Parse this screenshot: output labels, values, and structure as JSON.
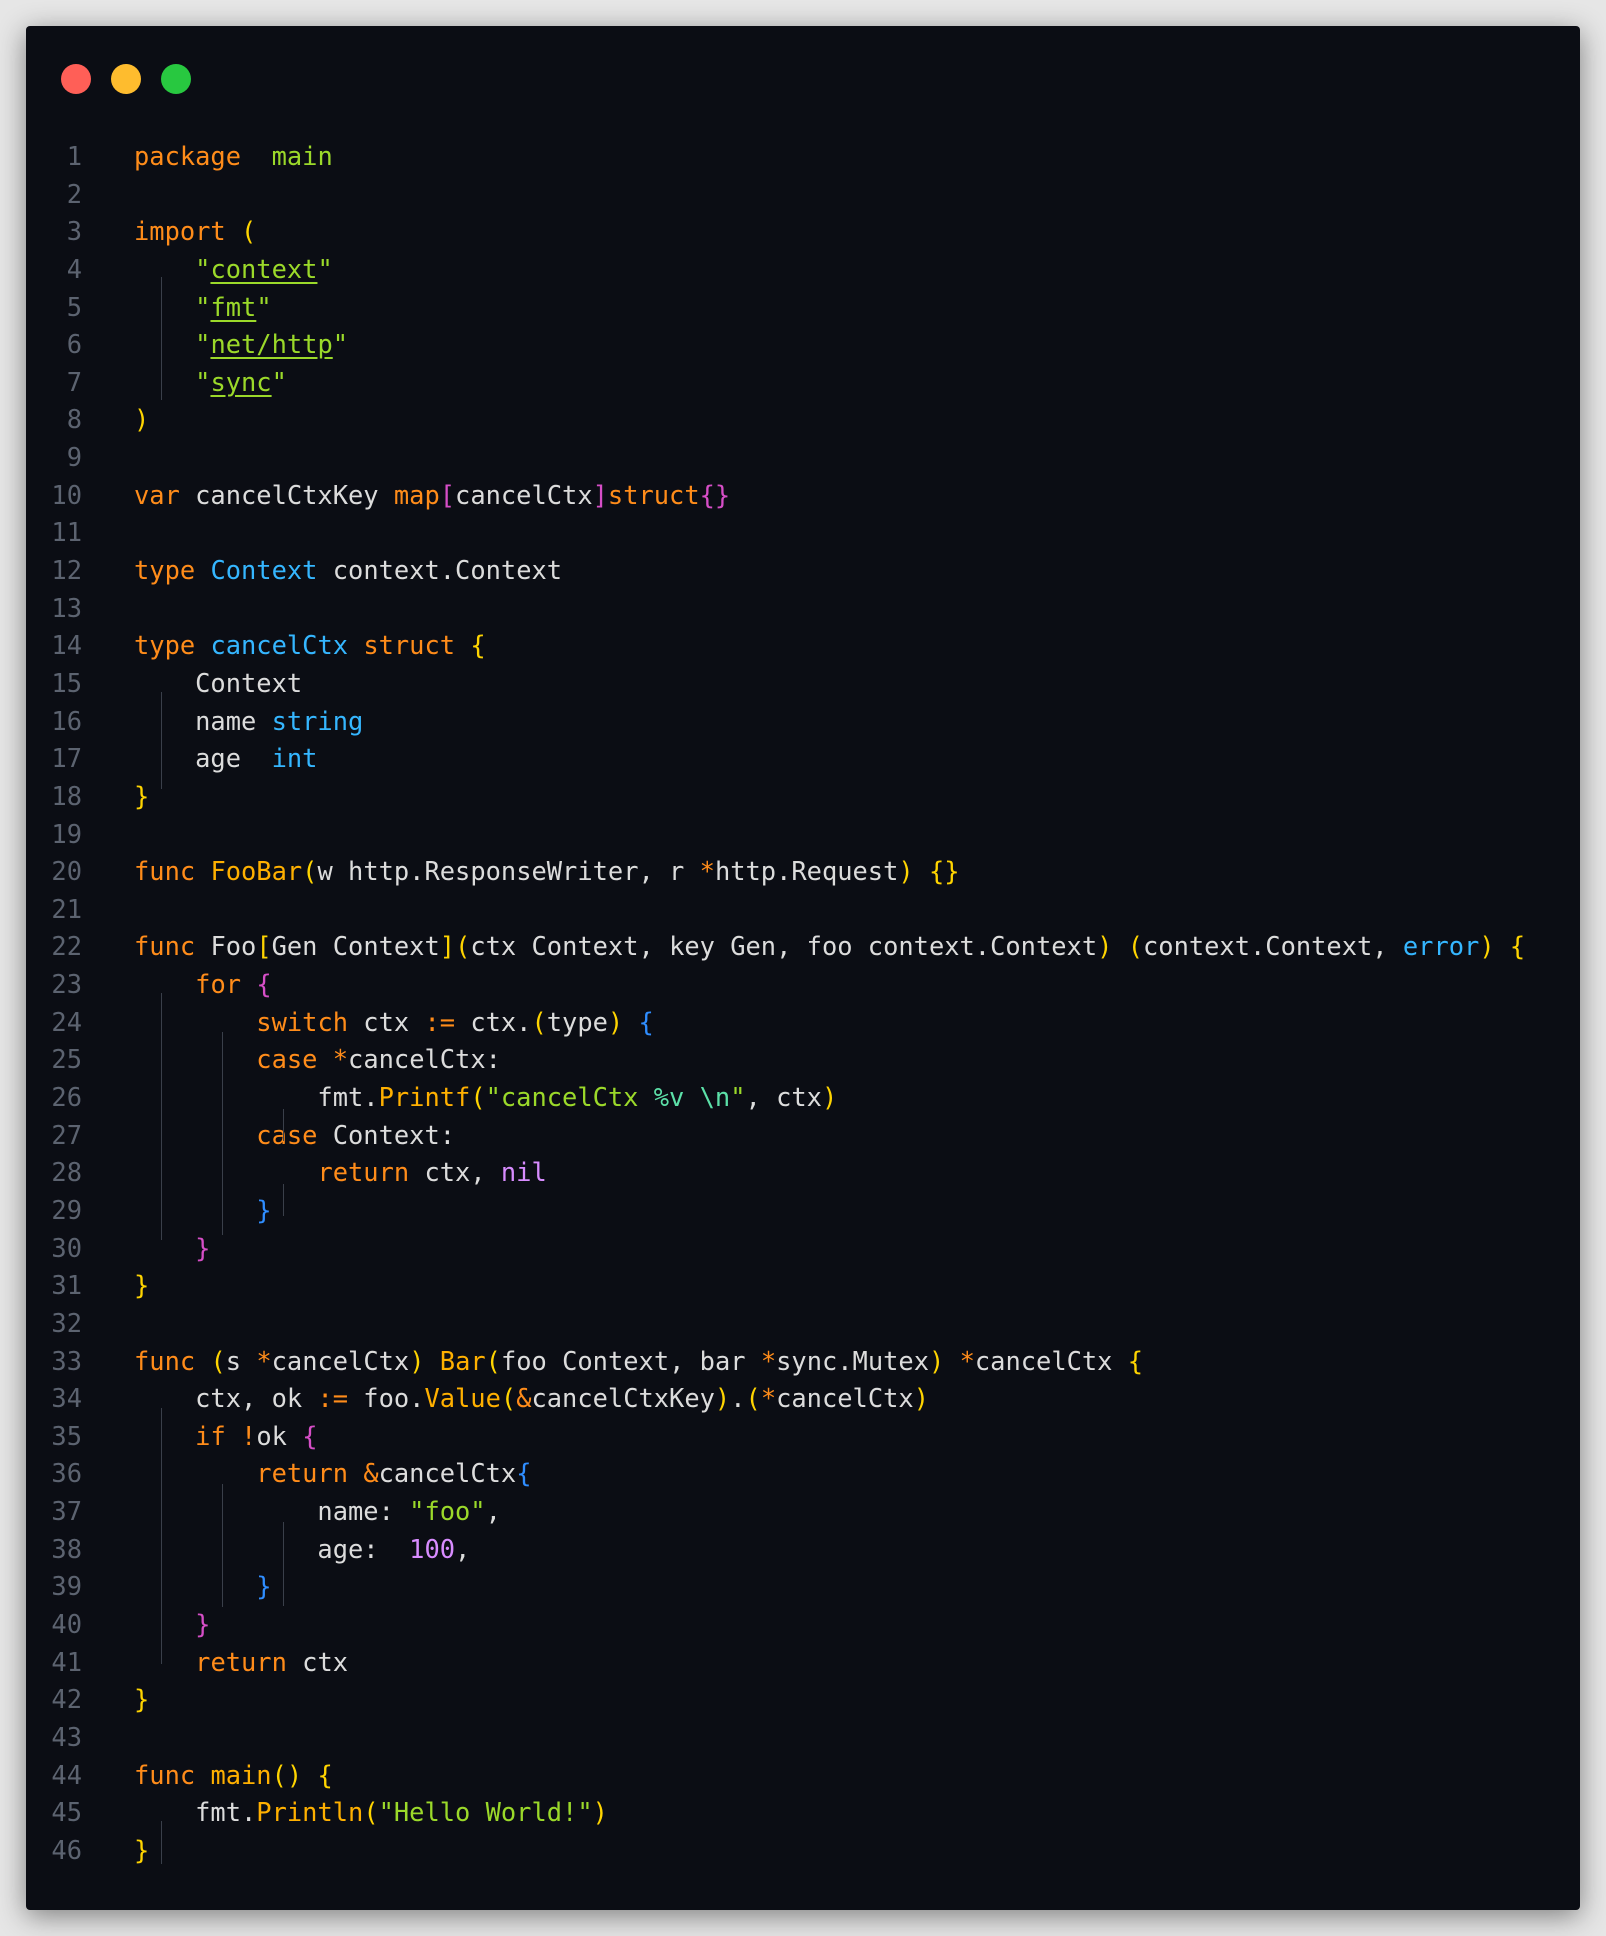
{
  "window": {
    "controls": [
      {
        "name": "close",
        "color": "#ff5f57"
      },
      {
        "name": "minimize",
        "color": "#febc2e"
      },
      {
        "name": "zoom",
        "color": "#28c840"
      }
    ]
  },
  "editor": {
    "language": "go",
    "lines": [
      {
        "n": "1",
        "tokens": [
          [
            "kw",
            "package"
          ],
          [
            "",
            "  "
          ],
          [
            "st",
            "main"
          ]
        ]
      },
      {
        "n": "2",
        "tokens": []
      },
      {
        "n": "3",
        "tokens": [
          [
            "kw",
            "import"
          ],
          [
            "",
            " "
          ],
          [
            "b1",
            "("
          ]
        ]
      },
      {
        "n": "4",
        "tokens": [
          [
            "",
            "    "
          ],
          [
            "st",
            "\""
          ],
          [
            "st u",
            "context"
          ],
          [
            "st",
            "\""
          ]
        ]
      },
      {
        "n": "5",
        "tokens": [
          [
            "",
            "    "
          ],
          [
            "st",
            "\""
          ],
          [
            "st u",
            "fmt"
          ],
          [
            "st",
            "\""
          ]
        ]
      },
      {
        "n": "6",
        "tokens": [
          [
            "",
            "    "
          ],
          [
            "st",
            "\""
          ],
          [
            "st u",
            "net/http"
          ],
          [
            "st",
            "\""
          ]
        ]
      },
      {
        "n": "7",
        "tokens": [
          [
            "",
            "    "
          ],
          [
            "st",
            "\""
          ],
          [
            "st u",
            "sync"
          ],
          [
            "st",
            "\""
          ]
        ]
      },
      {
        "n": "8",
        "tokens": [
          [
            "b1",
            ")"
          ]
        ]
      },
      {
        "n": "9",
        "tokens": []
      },
      {
        "n": "10",
        "tokens": [
          [
            "kw",
            "var"
          ],
          [
            "",
            " cancelCtxKey "
          ],
          [
            "kw",
            "map"
          ],
          [
            "b2",
            "["
          ],
          [
            "",
            "cancelCtx"
          ],
          [
            "b2",
            "]"
          ],
          [
            "kw",
            "struct"
          ],
          [
            "b2",
            "{}"
          ]
        ]
      },
      {
        "n": "11",
        "tokens": []
      },
      {
        "n": "12",
        "tokens": [
          [
            "kw",
            "type"
          ],
          [
            "",
            " "
          ],
          [
            "ty",
            "Context"
          ],
          [
            "",
            " context.Context"
          ]
        ]
      },
      {
        "n": "13",
        "tokens": []
      },
      {
        "n": "14",
        "tokens": [
          [
            "kw",
            "type"
          ],
          [
            "",
            " "
          ],
          [
            "ty",
            "cancelCtx"
          ],
          [
            "",
            " "
          ],
          [
            "kw",
            "struct"
          ],
          [
            "",
            " "
          ],
          [
            "b1",
            "{"
          ]
        ]
      },
      {
        "n": "15",
        "tokens": [
          [
            "",
            "    Context"
          ]
        ]
      },
      {
        "n": "16",
        "tokens": [
          [
            "",
            "    name "
          ],
          [
            "ty",
            "string"
          ]
        ]
      },
      {
        "n": "17",
        "tokens": [
          [
            "",
            "    age  "
          ],
          [
            "ty",
            "int"
          ]
        ]
      },
      {
        "n": "18",
        "tokens": [
          [
            "b1",
            "}"
          ]
        ]
      },
      {
        "n": "19",
        "tokens": []
      },
      {
        "n": "20",
        "tokens": [
          [
            "kw",
            "func"
          ],
          [
            "",
            " "
          ],
          [
            "fn",
            "FooBar"
          ],
          [
            "b1",
            "("
          ],
          [
            "",
            "w http.ResponseWriter, r "
          ],
          [
            "kw",
            "*"
          ],
          [
            "",
            "http.Request"
          ],
          [
            "b1",
            ")"
          ],
          [
            "",
            " "
          ],
          [
            "b1",
            "{}"
          ]
        ]
      },
      {
        "n": "21",
        "tokens": []
      },
      {
        "n": "22",
        "tokens": [
          [
            "kw",
            "func"
          ],
          [
            "",
            " Foo"
          ],
          [
            "b1",
            "["
          ],
          [
            "",
            "Gen Context"
          ],
          [
            "b1",
            "]"
          ],
          [
            "b1",
            "("
          ],
          [
            "",
            "ctx Context, key Gen, foo context.Context"
          ],
          [
            "b1",
            ")"
          ],
          [
            "",
            " "
          ],
          [
            "b1",
            "("
          ],
          [
            "",
            "context.Context, "
          ],
          [
            "ty",
            "error"
          ],
          [
            "b1",
            ")"
          ],
          [
            "",
            " "
          ],
          [
            "b1",
            "{"
          ]
        ]
      },
      {
        "n": "23",
        "tokens": [
          [
            "",
            "    "
          ],
          [
            "kw",
            "for"
          ],
          [
            "",
            " "
          ],
          [
            "b2",
            "{"
          ]
        ]
      },
      {
        "n": "24",
        "tokens": [
          [
            "",
            "        "
          ],
          [
            "kw",
            "switch"
          ],
          [
            "",
            " ctx "
          ],
          [
            "kw",
            ":="
          ],
          [
            "",
            " ctx."
          ],
          [
            "b1",
            "("
          ],
          [
            "",
            "type"
          ],
          [
            "b1",
            ")"
          ],
          [
            "",
            " "
          ],
          [
            "b3",
            "{"
          ]
        ]
      },
      {
        "n": "25",
        "tokens": [
          [
            "",
            "        "
          ],
          [
            "kw",
            "case"
          ],
          [
            "",
            " "
          ],
          [
            "kw",
            "*"
          ],
          [
            "",
            "cancelCtx:"
          ]
        ]
      },
      {
        "n": "26",
        "tokens": [
          [
            "",
            "            fmt."
          ],
          [
            "fn",
            "Printf"
          ],
          [
            "b1",
            "("
          ],
          [
            "st",
            "\"cancelCtx "
          ],
          [
            "esc",
            "%v"
          ],
          [
            "st",
            " "
          ],
          [
            "esc",
            "\\n"
          ],
          [
            "st",
            "\""
          ],
          [
            "",
            ", ctx"
          ],
          [
            "b1",
            ")"
          ]
        ]
      },
      {
        "n": "27",
        "tokens": [
          [
            "",
            "        "
          ],
          [
            "kw",
            "case"
          ],
          [
            "",
            " Context:"
          ]
        ]
      },
      {
        "n": "28",
        "tokens": [
          [
            "",
            "            "
          ],
          [
            "kw",
            "return"
          ],
          [
            "",
            " ctx, "
          ],
          [
            "nil",
            "nil"
          ]
        ]
      },
      {
        "n": "29",
        "tokens": [
          [
            "",
            "        "
          ],
          [
            "b3",
            "}"
          ]
        ]
      },
      {
        "n": "30",
        "tokens": [
          [
            "",
            "    "
          ],
          [
            "b2",
            "}"
          ]
        ]
      },
      {
        "n": "31",
        "tokens": [
          [
            "b1",
            "}"
          ]
        ]
      },
      {
        "n": "32",
        "tokens": []
      },
      {
        "n": "33",
        "tokens": [
          [
            "kw",
            "func"
          ],
          [
            "",
            " "
          ],
          [
            "b1",
            "("
          ],
          [
            "",
            "s "
          ],
          [
            "kw",
            "*"
          ],
          [
            "",
            "cancelCtx"
          ],
          [
            "b1",
            ")"
          ],
          [
            "",
            " "
          ],
          [
            "fn",
            "Bar"
          ],
          [
            "b1",
            "("
          ],
          [
            "",
            "foo Context, bar "
          ],
          [
            "kw",
            "*"
          ],
          [
            "",
            "sync.Mutex"
          ],
          [
            "b1",
            ")"
          ],
          [
            "",
            " "
          ],
          [
            "kw",
            "*"
          ],
          [
            "",
            "cancelCtx "
          ],
          [
            "b1",
            "{"
          ]
        ]
      },
      {
        "n": "34",
        "tokens": [
          [
            "",
            "    ctx, ok "
          ],
          [
            "kw",
            ":="
          ],
          [
            "",
            " foo."
          ],
          [
            "fn",
            "Value"
          ],
          [
            "b1",
            "("
          ],
          [
            "kw",
            "&"
          ],
          [
            "",
            "cancelCtxKey"
          ],
          [
            "b1",
            ")"
          ],
          [
            "",
            "."
          ],
          [
            "b1",
            "("
          ],
          [
            "kw",
            "*"
          ],
          [
            "",
            "cancelCtx"
          ],
          [
            "b1",
            ")"
          ]
        ]
      },
      {
        "n": "35",
        "tokens": [
          [
            "",
            "    "
          ],
          [
            "kw",
            "if"
          ],
          [
            "",
            " "
          ],
          [
            "kw",
            "!"
          ],
          [
            "",
            "ok "
          ],
          [
            "b2",
            "{"
          ]
        ]
      },
      {
        "n": "36",
        "tokens": [
          [
            "",
            "        "
          ],
          [
            "kw",
            "return"
          ],
          [
            "",
            " "
          ],
          [
            "kw",
            "&"
          ],
          [
            "",
            "cancelCtx"
          ],
          [
            "b3",
            "{"
          ]
        ]
      },
      {
        "n": "37",
        "tokens": [
          [
            "",
            "            name: "
          ],
          [
            "st",
            "\"foo\""
          ],
          [
            "",
            ","
          ]
        ]
      },
      {
        "n": "38",
        "tokens": [
          [
            "",
            "            age:  "
          ],
          [
            "num",
            "100"
          ],
          [
            "",
            ","
          ]
        ]
      },
      {
        "n": "39",
        "tokens": [
          [
            "",
            "        "
          ],
          [
            "b3",
            "}"
          ]
        ]
      },
      {
        "n": "40",
        "tokens": [
          [
            "",
            "    "
          ],
          [
            "b2",
            "}"
          ]
        ]
      },
      {
        "n": "41",
        "tokens": [
          [
            "",
            "    "
          ],
          [
            "kw",
            "return"
          ],
          [
            "",
            " ctx"
          ]
        ]
      },
      {
        "n": "42",
        "tokens": [
          [
            "b1",
            "}"
          ]
        ]
      },
      {
        "n": "43",
        "tokens": []
      },
      {
        "n": "44",
        "tokens": [
          [
            "kw",
            "func"
          ],
          [
            "",
            " "
          ],
          [
            "fn",
            "main"
          ],
          [
            "b1",
            "()"
          ],
          [
            "",
            " "
          ],
          [
            "b1",
            "{"
          ]
        ]
      },
      {
        "n": "45",
        "tokens": [
          [
            "",
            "    fmt."
          ],
          [
            "fn",
            "Println"
          ],
          [
            "b1",
            "("
          ],
          [
            "st",
            "\"Hello World!\""
          ],
          [
            "b1",
            ")"
          ]
        ]
      },
      {
        "n": "46",
        "tokens": [
          [
            "b1",
            "}"
          ]
        ]
      }
    ],
    "colors": {
      "background": "#0b0d14",
      "keyword": "#ff8c1a",
      "function": "#ffb000",
      "type": "#35b6ff",
      "string": "#9bd92a",
      "number": "#d88cff",
      "bracket_level_1": "#ffd400",
      "bracket_level_2": "#d64ec7",
      "bracket_level_3": "#2f8dff"
    }
  }
}
